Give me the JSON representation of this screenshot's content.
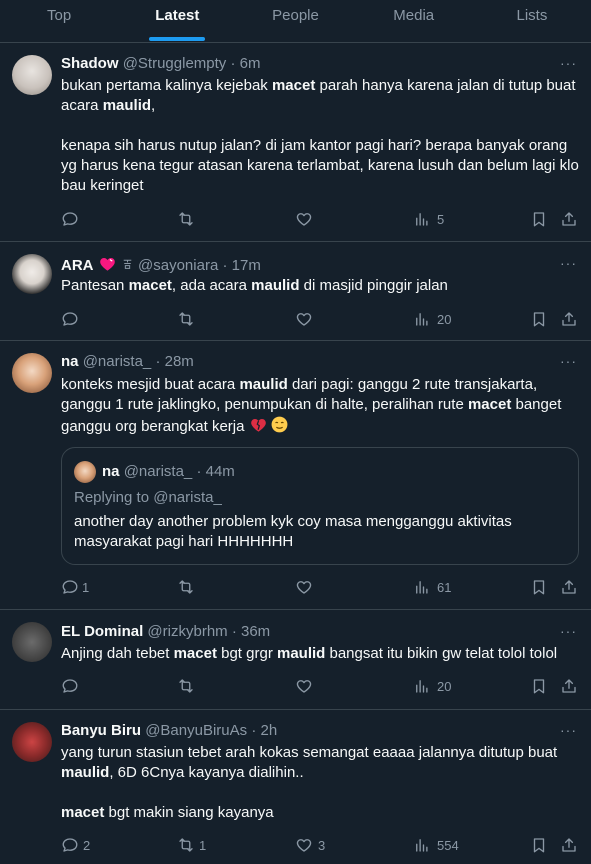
{
  "tabs": [
    {
      "label": "Top"
    },
    {
      "label": "Latest"
    },
    {
      "label": "People"
    },
    {
      "label": "Media"
    },
    {
      "label": "Lists"
    }
  ],
  "active_tab": "Latest",
  "more_icon": "···",
  "tweets": [
    {
      "name": "Shadow",
      "handle": "@Strugglempty",
      "time": "· 6m",
      "p1_a": "bukan pertama kalinya kejebak ",
      "p1_b": "macet",
      "p1_c": " parah hanya karena jalan di tutup buat acara ",
      "p1_d": "maulid",
      "p1_e": ",",
      "p2": "kenapa sih harus nutup jalan? di jam kantor pagi hari? berapa banyak orang yg harus kena tegur atasan karena terlambat, karena lusuh dan belum lagi klo bau keringet",
      "views": "5"
    },
    {
      "name": "ARA",
      "handle": "@sayoniara",
      "time": "· 17m",
      "p1_a": "Pantesan ",
      "p1_b": "macet",
      "p1_c": ", ada acara ",
      "p1_d": "maulid",
      "p1_e": " di masjid pinggir jalan",
      "views": "20"
    },
    {
      "name": "na",
      "handle": "@narista_",
      "time": "· 28m",
      "p1_a": "konteks mesjid buat acara ",
      "p1_b": "maulid",
      "p1_c": " dari pagi: ganggu 2 rute transjakarta, ganggu 1 rute jaklingko, penumpukan di halte, peralihan rute ",
      "p1_d": "macet",
      "p1_e": " banget ganggu org berangkat kerja ",
      "replies": "1",
      "views": "61",
      "quote": {
        "name": "na",
        "handle": "@narista_",
        "time": "· 44m",
        "replying": "Replying to @narista_",
        "text": "another day another problem kyk coy masa mengganggu aktivitas masyarakat pagi hari HHHHHHH"
      }
    },
    {
      "name": "EL Dominal",
      "handle": "@rizkybrhm",
      "time": "· 36m",
      "p1_a": "Anjing dah tebet ",
      "p1_b": "macet",
      "p1_c": " bgt grgr ",
      "p1_d": "maulid",
      "p1_e": " bangsat itu bikin gw telat tolol tolol",
      "views": "20"
    },
    {
      "name": "Banyu Biru",
      "handle": "@BanyuBiruAs",
      "time": "· 2h",
      "p1_a": "yang turun stasiun tebet arah kokas semangat eaaaa jalannya ditutup buat ",
      "p1_b": "maulid",
      "p1_c": ", 6D 6Cnya kayanya dialihin..",
      "p2_a": "macet",
      "p2_b": " bgt makin siang kayanya",
      "replies": "2",
      "retweets": "1",
      "likes": "3",
      "views": "554"
    }
  ],
  "colors": {
    "background": "#15202b",
    "border": "#38444d",
    "accent": "#1d9bf0",
    "muted": "#8b98a5",
    "text": "#f7f9f9"
  }
}
